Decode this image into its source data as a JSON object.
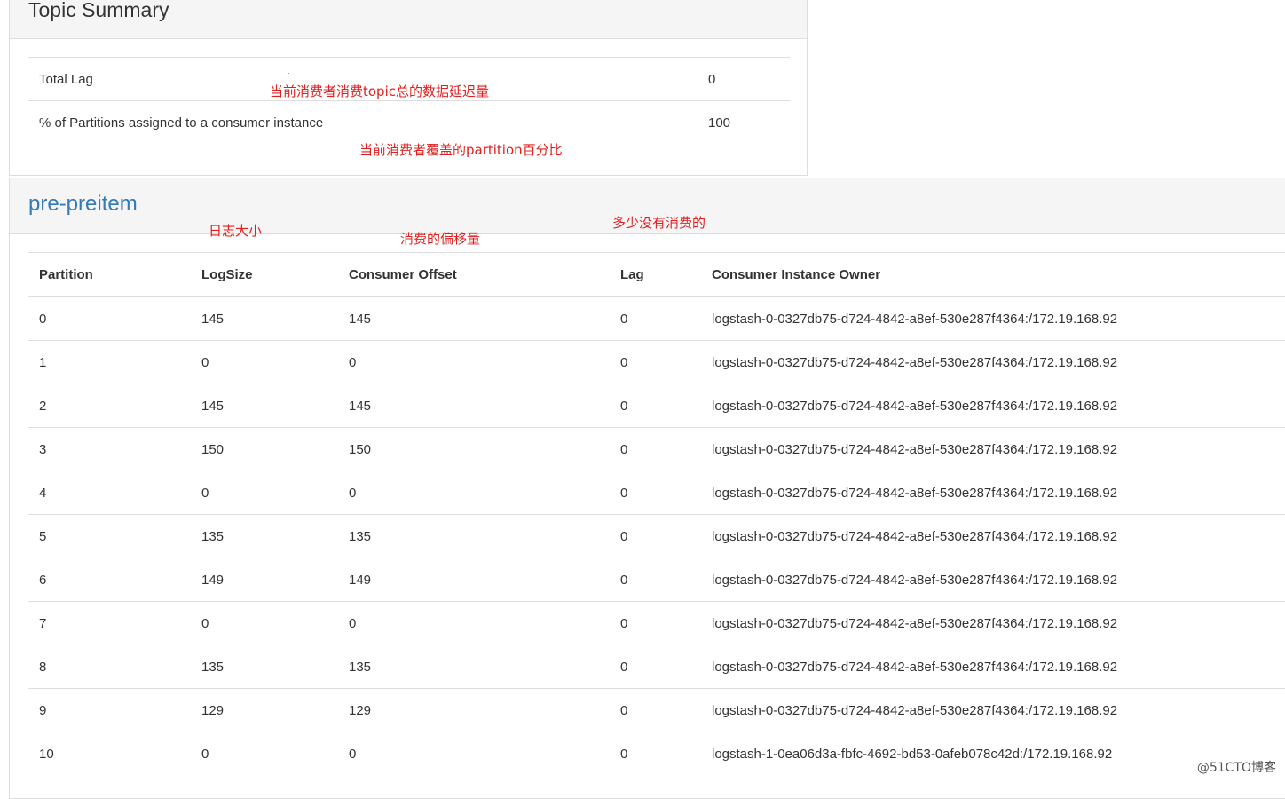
{
  "summary": {
    "title": "Topic Summary",
    "rows": [
      {
        "label": "Total Lag",
        "value": "0"
      },
      {
        "label": "% of Partitions assigned to a consumer instance",
        "value": "100"
      }
    ]
  },
  "topic": {
    "name": "pre-preitem",
    "columns": [
      "Partition",
      "LogSize",
      "Consumer Offset",
      "Lag",
      "Consumer Instance Owner"
    ],
    "rows": [
      [
        "0",
        "145",
        "145",
        "0",
        "logstash-0-0327db75-d724-4842-a8ef-530e287f4364:/172.19.168.92"
      ],
      [
        "1",
        "0",
        "0",
        "0",
        "logstash-0-0327db75-d724-4842-a8ef-530e287f4364:/172.19.168.92"
      ],
      [
        "2",
        "145",
        "145",
        "0",
        "logstash-0-0327db75-d724-4842-a8ef-530e287f4364:/172.19.168.92"
      ],
      [
        "3",
        "150",
        "150",
        "0",
        "logstash-0-0327db75-d724-4842-a8ef-530e287f4364:/172.19.168.92"
      ],
      [
        "4",
        "0",
        "0",
        "0",
        "logstash-0-0327db75-d724-4842-a8ef-530e287f4364:/172.19.168.92"
      ],
      [
        "5",
        "135",
        "135",
        "0",
        "logstash-0-0327db75-d724-4842-a8ef-530e287f4364:/172.19.168.92"
      ],
      [
        "6",
        "149",
        "149",
        "0",
        "logstash-0-0327db75-d724-4842-a8ef-530e287f4364:/172.19.168.92"
      ],
      [
        "7",
        "0",
        "0",
        "0",
        "logstash-0-0327db75-d724-4842-a8ef-530e287f4364:/172.19.168.92"
      ],
      [
        "8",
        "135",
        "135",
        "0",
        "logstash-0-0327db75-d724-4842-a8ef-530e287f4364:/172.19.168.92"
      ],
      [
        "9",
        "129",
        "129",
        "0",
        "logstash-0-0327db75-d724-4842-a8ef-530e287f4364:/172.19.168.92"
      ],
      [
        "10",
        "0",
        "0",
        "0",
        "logstash-1-0ea06d3a-fbfc-4692-bd53-0afeb078c42d:/172.19.168.92"
      ]
    ]
  },
  "annotations": {
    "total_lag": "当前消费者消费topic总的数据延迟量",
    "partitions_pct": "当前消费者覆盖的partition百分比",
    "logsize": "日志大小",
    "offset": "消费的偏移量",
    "lag": "多少没有消费的"
  },
  "watermark": "@51CTO博客",
  "colors": {
    "link": "#337ab7",
    "annotation": "#e02020",
    "panel_header": "#f5f5f5",
    "border": "#dddddd"
  }
}
